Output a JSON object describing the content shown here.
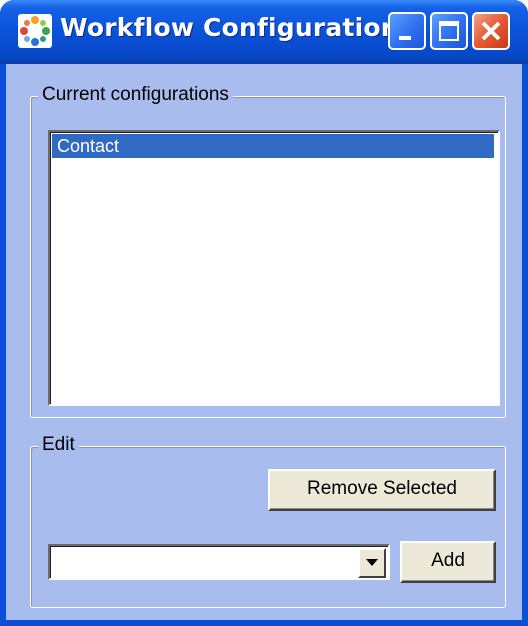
{
  "window": {
    "title": "Workflow Configuration",
    "icon": "workflow-app-icon",
    "controls": {
      "minimize_icon": "minimize-icon",
      "maximize_icon": "maximize-icon",
      "close_icon": "close-icon"
    },
    "colors": {
      "titlebar": "#0a52d8",
      "client_background": "#a8bcee",
      "selection": "#316ac5",
      "close_button": "#e35a35"
    }
  },
  "current_configurations": {
    "label": "Current configurations",
    "items": [
      {
        "label": "Contact",
        "selected": true
      }
    ]
  },
  "edit": {
    "label": "Edit",
    "remove_button_label": "Remove Selected",
    "combo": {
      "value": "",
      "arrow_icon": "dropdown-arrow-icon"
    },
    "add_button_label": "Add"
  }
}
